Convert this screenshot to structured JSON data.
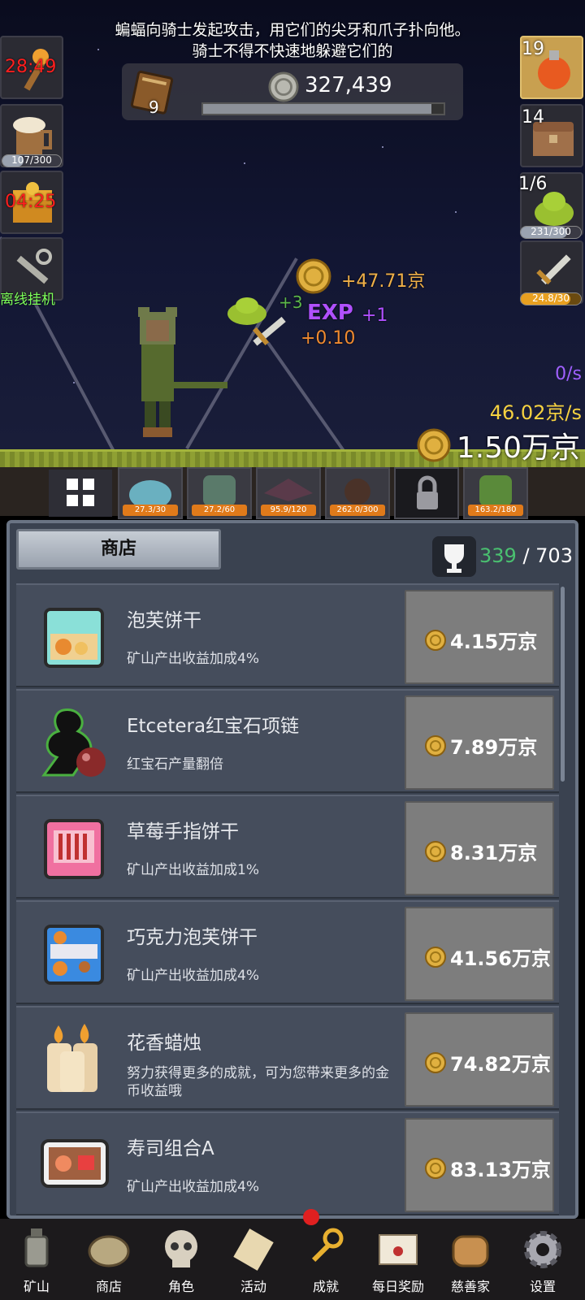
{
  "scene": {
    "story_line1": "蝙蝠向骑士发起攻击，用它们的尖牙和爪子扑向他。",
    "story_line2": "骑士不得不快速地躲避它们的",
    "book_count": "9",
    "gold_total": "327,439",
    "topbar_progress": 0.95,
    "left_buttons": {
      "torch_timer": "28:49",
      "beer_progress_text": "107/300",
      "beer_progress": 0.36,
      "chest_timer": "04:25",
      "offline_label": "离线挂机"
    },
    "right_buttons": {
      "potion_count": "19",
      "chest_count": "14",
      "slime_count": "1/6",
      "slime_progress_text": "231/300",
      "slime_progress": 0.77,
      "sword_progress_text": "24.8/30",
      "sword_progress": 0.83
    },
    "floating": {
      "gold_gain": "+47.71京",
      "plus3": "+3",
      "exp_label": "EXP",
      "exp_gain": "+1",
      "small_gain": "+0.10"
    },
    "rate_zero": "0/s",
    "rate_gold": "46.02京/s",
    "gold_current": "1.50万京"
  },
  "monsters": [
    {
      "progress_text": "27.3/30"
    },
    {
      "progress_text": "27.2/60"
    },
    {
      "progress_text": "95.9/120"
    },
    {
      "progress_text": "262.0/300"
    },
    {
      "progress_text": ""
    },
    {
      "progress_text": "163.2/180"
    }
  ],
  "shop": {
    "tab_label": "商店",
    "trophy_got": "339",
    "trophy_sep": " / ",
    "trophy_total": "703",
    "items": [
      {
        "name": "泡芙饼干",
        "desc": "矿山产出收益加成4%",
        "price": "4.15万京",
        "icon": "cream-puff-biscuit-icon"
      },
      {
        "name": "Etcetera红宝石项链",
        "desc": "红宝石产量翻倍",
        "price": "7.89万京",
        "icon": "ruby-necklace-icon"
      },
      {
        "name": "草莓手指饼干",
        "desc": "矿山产出收益加成1%",
        "price": "8.31万京",
        "icon": "strawberry-sticks-icon"
      },
      {
        "name": "巧克力泡芙饼干",
        "desc": "矿山产出收益加成4%",
        "price": "41.56万京",
        "icon": "chocolate-puff-biscuit-icon"
      },
      {
        "name": "花香蜡烛",
        "desc": "努力获得更多的成就，可为您带来更多的金币收益哦",
        "price": "74.82万京",
        "icon": "candle-icon"
      },
      {
        "name": "寿司组合A",
        "desc": "矿山产出收益加成4%",
        "price": "83.13万京",
        "icon": "sushi-set-icon"
      }
    ]
  },
  "nav": [
    {
      "label": "矿山",
      "icon": "lantern-icon"
    },
    {
      "label": "商店",
      "icon": "ore-icon"
    },
    {
      "label": "角色",
      "icon": "skull-icon"
    },
    {
      "label": "活动",
      "icon": "scroll-icon"
    },
    {
      "label": "成就",
      "icon": "key-icon"
    },
    {
      "label": "每日奖励",
      "icon": "letter-icon"
    },
    {
      "label": "慈善家",
      "icon": "bread-icon"
    },
    {
      "label": "设置",
      "icon": "gear-icon"
    }
  ],
  "colors": {
    "panel_bg": "#3a4250",
    "buy_button": "#7d7d7d",
    "timer_red": "#ff1e1e",
    "gold_rate": "#f6d240",
    "trophy_got": "#4ac070"
  }
}
